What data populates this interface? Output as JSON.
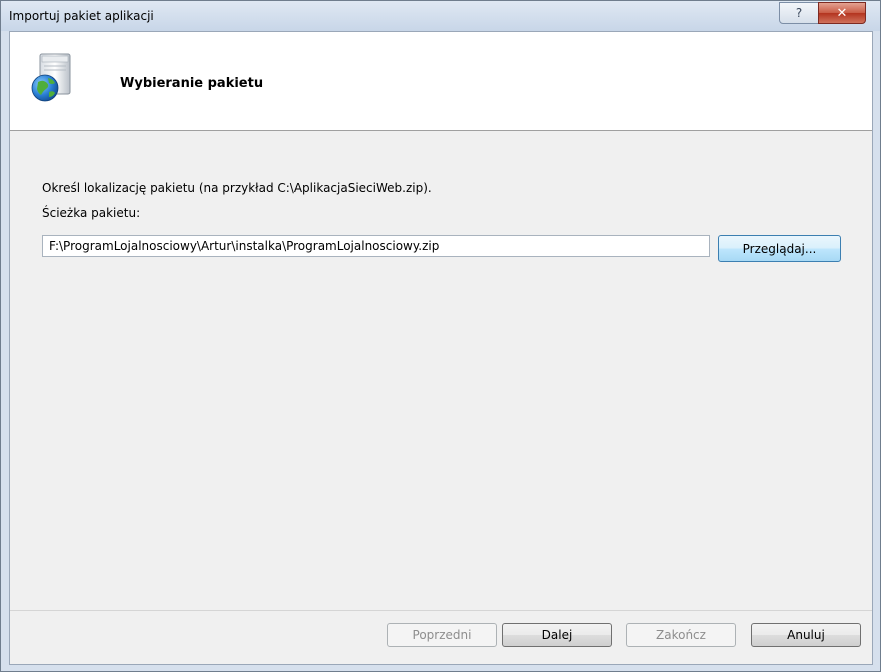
{
  "window": {
    "title": "Importuj pakiet aplikacji",
    "help_label": "?",
    "close_label": "✕"
  },
  "header": {
    "title": "Wybieranie pakietu",
    "icon": "package-globe-icon"
  },
  "content": {
    "description": "Określ lokalizację pakietu (na przykład C:\\AplikacjaSieciWeb.zip).",
    "path_label": "Ścieżka pakietu:",
    "path_value": "F:\\ProgramLojalnosciowy\\Artur\\instalka\\ProgramLojalnosciowy.zip",
    "browse_label": "Przeglądaj..."
  },
  "footer": {
    "prev_label": "Poprzedni",
    "next_label": "Dalej",
    "finish_label": "Zakończ",
    "cancel_label": "Anuluj"
  }
}
